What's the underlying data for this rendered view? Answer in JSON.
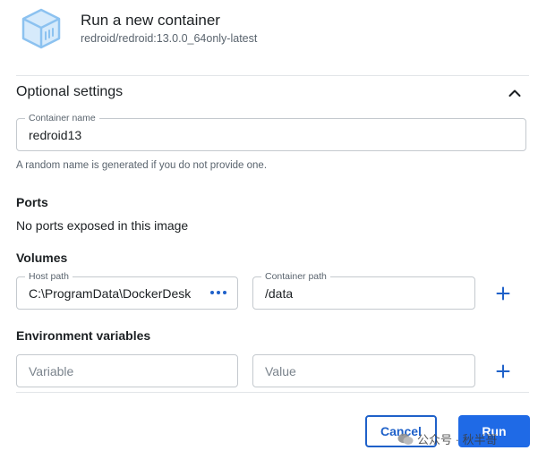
{
  "header": {
    "title": "Run a new container",
    "subtitle": "redroid/redroid:13.0.0_64only-latest"
  },
  "optional_settings": {
    "title": "Optional settings",
    "container_name": {
      "label": "Container name",
      "value": "redroid13"
    },
    "helper_text": "A random name is generated if you do not provide one."
  },
  "ports": {
    "heading": "Ports",
    "text": "No ports exposed in this image"
  },
  "volumes": {
    "heading": "Volumes",
    "host_path": {
      "label": "Host path",
      "value": "C:\\ProgramData\\DockerDesk"
    },
    "container_path": {
      "label": "Container path",
      "value": "/data"
    }
  },
  "env": {
    "heading": "Environment variables",
    "variable_placeholder": "Variable",
    "value_placeholder": "Value"
  },
  "actions": {
    "cancel_label": "Cancel",
    "run_label": "Run"
  },
  "watermark": {
    "text": "公众号 · 秋半哥"
  },
  "colors": {
    "accent": "#1f6ae6",
    "icon_blue": "#8cc2f0"
  }
}
